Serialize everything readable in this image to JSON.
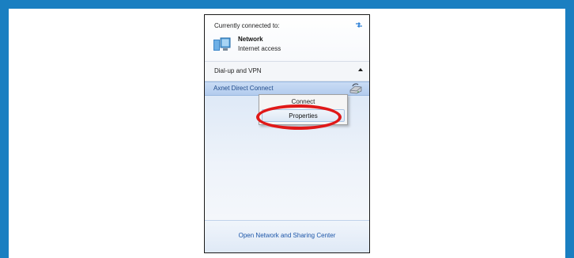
{
  "popup": {
    "header": {
      "connected_label": "Currently connected to:",
      "network_name": "Network",
      "network_status": "Internet access",
      "refresh_icon": "refresh-arrows-icon",
      "network_icon": "network-computer-icon"
    },
    "dialup_section": {
      "label": "Dial-up and VPN",
      "collapse_icon": "chevron-up-icon"
    },
    "connection": {
      "name": "Axnet Direct Connect",
      "icon": "modem-icon"
    },
    "context_menu": {
      "items": [
        {
          "label": "Connect"
        },
        {
          "label": "Properties"
        }
      ]
    },
    "footer": {
      "link_label": "Open Network and Sharing Center"
    }
  },
  "colors": {
    "border_accent": "#1a7fc1",
    "highlight_ring": "#e01818",
    "link": "#1b55a8",
    "selected_row": "#b3ccee"
  }
}
